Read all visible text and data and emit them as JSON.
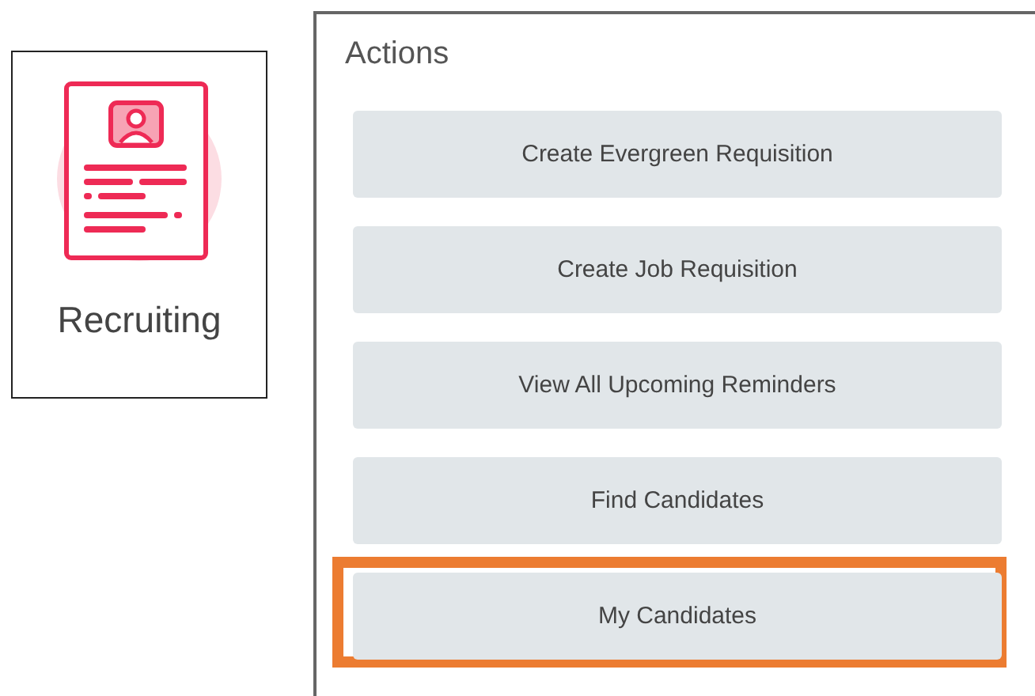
{
  "app_tile": {
    "label": "Recruiting"
  },
  "actions": {
    "title": "Actions",
    "buttons": [
      {
        "label": "Create Evergreen Requisition",
        "highlighted": false
      },
      {
        "label": "Create Job Requisition",
        "highlighted": false
      },
      {
        "label": "View All Upcoming Reminders",
        "highlighted": false
      },
      {
        "label": "Find Candidates",
        "highlighted": false
      },
      {
        "label": "My Candidates",
        "highlighted": true
      }
    ]
  }
}
